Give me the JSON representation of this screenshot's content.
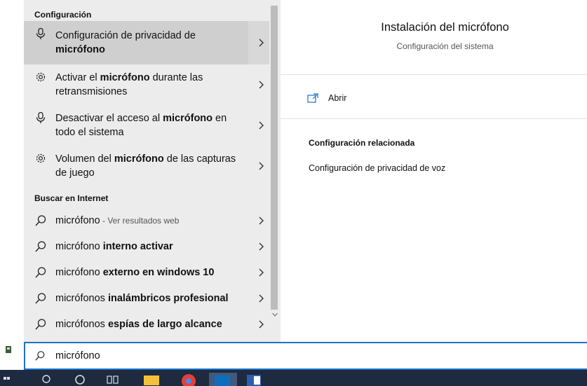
{
  "left": {
    "section_config": "Configuración",
    "section_web": "Buscar en Internet",
    "settings_results": [
      {
        "pre": "Configuración de privacidad de ",
        "bold": "micrófono",
        "post": "",
        "icon": "microphone-icon"
      },
      {
        "pre": "Activar el ",
        "bold": "micrófono",
        "post": " durante las retransmisiones",
        "icon": "gear-icon"
      },
      {
        "pre": "Desactivar el acceso al ",
        "bold": "micrófono",
        "post": " en todo el sistema",
        "icon": "microphone-icon"
      },
      {
        "pre": "Volumen del ",
        "bold": "micrófono",
        "post": " de las capturas de juego",
        "icon": "gear-icon"
      }
    ],
    "web_results": [
      {
        "pre": "micrófono",
        "bold": "",
        "hint": " - Ver resultados web"
      },
      {
        "pre": "micrófono ",
        "bold": "interno activar",
        "hint": ""
      },
      {
        "pre": "micrófono ",
        "bold": "externo en windows 10",
        "hint": ""
      },
      {
        "pre": "micrófonos ",
        "bold": "inalámbricos profesional",
        "hint": ""
      },
      {
        "pre": "micrófonos ",
        "bold": "espías de largo alcance",
        "hint": ""
      }
    ]
  },
  "detail": {
    "title": "Instalación del micrófono",
    "subtitle": "Configuración del sistema",
    "open_label": "Abrir",
    "related_title": "Configuración relacionada",
    "related_link": "Configuración de privacidad de voz"
  },
  "search": {
    "value": "micrófono"
  },
  "colors": {
    "search_border": "#1a73c9",
    "taskbar": "#1d2a3f",
    "selected": "#cfcfcf"
  }
}
